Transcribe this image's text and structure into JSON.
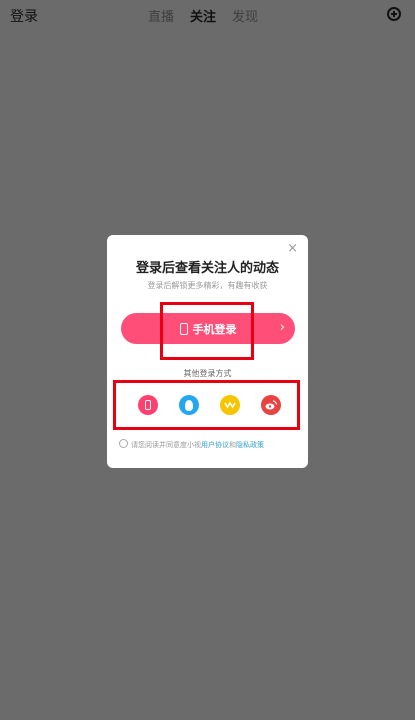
{
  "topbar": {
    "login_label": "登录",
    "tabs": [
      {
        "label": "直播",
        "active": false
      },
      {
        "label": "关注",
        "active": true
      },
      {
        "label": "发现",
        "active": false
      }
    ]
  },
  "dialog": {
    "close": "×",
    "title": "登录后查看关注人的动态",
    "subtitle": "登录后解锁更多精彩，有趣有收获",
    "phone_login": "手机登录",
    "chevron": "›",
    "other_methods": "其他登录方式",
    "agreement_prefix": "请您阅读并同意度小视",
    "agreement_user": "用户协议",
    "agreement_and": "和",
    "agreement_privacy": "隐私政策",
    "icons": [
      "phone-icon",
      "qq-icon",
      "wechat-pay-icon",
      "weibo-icon"
    ]
  },
  "colors": {
    "primary": "#ff4f79",
    "qq": "#23a8f0",
    "yellow": "#f7c400",
    "weibo": "#e84340",
    "highlight": "#e60012"
  }
}
